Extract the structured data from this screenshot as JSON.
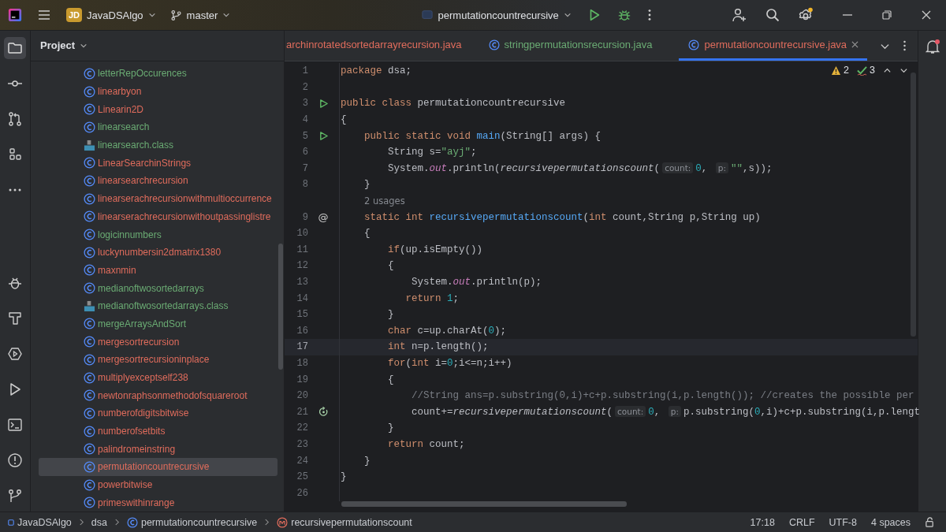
{
  "title_bar": {
    "project_badge": "JD",
    "project": "JavaDSAlgo",
    "branch": "master",
    "run_config": "permutationcountrecursive"
  },
  "project_panel": {
    "title": "Project",
    "items": [
      {
        "name": "letterRepOccurences",
        "kind": "class",
        "color": "#6aab73",
        "selected": false
      },
      {
        "name": "linearbyon",
        "kind": "class",
        "color": "#e06c5c",
        "selected": false
      },
      {
        "name": "Linearin2D",
        "kind": "class",
        "color": "#e06c5c",
        "selected": false
      },
      {
        "name": "linearsearch",
        "kind": "class",
        "color": "#6aab73",
        "selected": false
      },
      {
        "name": "linearsearch.class",
        "kind": "classfile",
        "color": "#6aab73",
        "selected": false
      },
      {
        "name": "LinearSearchinStrings",
        "kind": "class",
        "color": "#e06c5c",
        "selected": false
      },
      {
        "name": "linearsearchrecursion",
        "kind": "class",
        "color": "#e06c5c",
        "selected": false
      },
      {
        "name": "linearserachrecursionwithmultioccurrence",
        "kind": "class",
        "color": "#e06c5c",
        "selected": false
      },
      {
        "name": "linearserachrecursionwithoutpassinglistre",
        "kind": "class",
        "color": "#e06c5c",
        "selected": false
      },
      {
        "name": "logicinnumbers",
        "kind": "class",
        "color": "#6aab73",
        "selected": false
      },
      {
        "name": "luckynumbersin2dmatrix1380",
        "kind": "class",
        "color": "#e06c5c",
        "selected": false
      },
      {
        "name": "maxnmin",
        "kind": "class",
        "color": "#e06c5c",
        "selected": false
      },
      {
        "name": "medianoftwosortedarrays",
        "kind": "class",
        "color": "#6aab73",
        "selected": false
      },
      {
        "name": "medianoftwosortedarrays.class",
        "kind": "classfile",
        "color": "#6aab73",
        "selected": false
      },
      {
        "name": "mergeArraysAndSort",
        "kind": "class",
        "color": "#6aab73",
        "selected": false
      },
      {
        "name": "mergesortrecursion",
        "kind": "class",
        "color": "#e06c5c",
        "selected": false
      },
      {
        "name": "mergesortrecursioninplace",
        "kind": "class",
        "color": "#e06c5c",
        "selected": false
      },
      {
        "name": "multiplyexceptself238",
        "kind": "class",
        "color": "#e06c5c",
        "selected": false
      },
      {
        "name": "newtonraphsonmethodofsquareroot",
        "kind": "class",
        "color": "#e06c5c",
        "selected": false
      },
      {
        "name": "numberofdigitsbitwise",
        "kind": "class",
        "color": "#e06c5c",
        "selected": false
      },
      {
        "name": "numberofsetbits",
        "kind": "class",
        "color": "#e06c5c",
        "selected": false
      },
      {
        "name": "palindromeinstring",
        "kind": "class",
        "color": "#e06c5c",
        "selected": false
      },
      {
        "name": "permutationcountrecursive",
        "kind": "class",
        "color": "#e06c5c",
        "selected": true
      },
      {
        "name": "powerbitwise",
        "kind": "class",
        "color": "#e06c5c",
        "selected": false
      },
      {
        "name": "primeswithinrange",
        "kind": "class",
        "color": "#e06c5c",
        "selected": false
      }
    ]
  },
  "editor_tabs": [
    {
      "label": "archinrotatedsortedarrayrecursion.java",
      "icon": false,
      "color": "#e06c5c",
      "selected": false
    },
    {
      "label": "stringpermutationsrecursion.java",
      "icon": true,
      "color": "#6aab73",
      "selected": false
    },
    {
      "label": "permutationcountrecursive.java",
      "icon": true,
      "color": "#e06c5c",
      "selected": true
    }
  ],
  "inspections": {
    "warnings": "2",
    "weak_warnings": "3"
  },
  "code": [
    {
      "number": "1",
      "tokens": [
        {
          "kind": "kw",
          "text": "package"
        },
        {
          "kind": "plain",
          "text": " dsa;"
        }
      ]
    },
    {
      "number": "2"
    },
    {
      "number": "3",
      "gutter": {
        "kind": "run"
      },
      "tokens": [
        {
          "kind": "kw",
          "text": "public class "
        },
        {
          "kind": "plain",
          "text": "permutationcountrecursive"
        }
      ]
    },
    {
      "number": "4",
      "tokens": [
        {
          "kind": "plain",
          "text": "{"
        }
      ]
    },
    {
      "number": "5",
      "gutter": {
        "kind": "run"
      },
      "tokens": [
        {
          "kind": "kw",
          "text": "    public static void "
        },
        {
          "kind": "decl",
          "text": "main"
        },
        {
          "kind": "plain",
          "text": "(String[] args) {"
        }
      ]
    },
    {
      "number": "6",
      "tokens": [
        {
          "kind": "plain",
          "text": "        String s="
        },
        {
          "kind": "str",
          "text": "\"ayj\""
        },
        {
          "kind": "plain",
          "text": ";"
        }
      ]
    },
    {
      "number": "7",
      "tokens": [
        {
          "kind": "plain",
          "text": "        System."
        },
        {
          "kind": "field",
          "text": "out"
        },
        {
          "kind": "plain",
          "text": ".println("
        },
        {
          "kind": "call",
          "text": "recursivepermutationscount"
        },
        {
          "kind": "plain",
          "text": "("
        },
        {
          "kind": "hint",
          "text": "count:"
        },
        {
          "kind": "num",
          "text": "0"
        },
        {
          "kind": "plain",
          "text": ", "
        },
        {
          "kind": "hint",
          "text": "p:"
        },
        {
          "kind": "str",
          "text": "\"\""
        },
        {
          "kind": "plain",
          "text": ",s));"
        }
      ]
    },
    {
      "number": "8",
      "tokens": [
        {
          "kind": "plain",
          "text": "    }"
        }
      ]
    },
    {
      "usages": "2 usages"
    },
    {
      "number": "9",
      "gutter": {
        "kind": "annotation",
        "text": "@"
      },
      "tokens": [
        {
          "kind": "kw",
          "text": "    static int "
        },
        {
          "kind": "decl",
          "text": "recursivepermutationscount"
        },
        {
          "kind": "plain",
          "text": "("
        },
        {
          "kind": "kw",
          "text": "int "
        },
        {
          "kind": "plain",
          "text": "count,String p,String up)"
        }
      ]
    },
    {
      "number": "10",
      "tokens": [
        {
          "kind": "plain",
          "text": "    {"
        }
      ]
    },
    {
      "number": "11",
      "tokens": [
        {
          "kind": "kw",
          "text": "        if"
        },
        {
          "kind": "plain",
          "text": "(up.isEmpty())"
        }
      ]
    },
    {
      "number": "12",
      "tokens": [
        {
          "kind": "plain",
          "text": "        {"
        }
      ]
    },
    {
      "number": "13",
      "tokens": [
        {
          "kind": "plain",
          "text": "            System."
        },
        {
          "kind": "field",
          "text": "out"
        },
        {
          "kind": "plain",
          "text": ".println(p);"
        }
      ]
    },
    {
      "number": "14",
      "tokens": [
        {
          "kind": "kw",
          "text": "           return "
        },
        {
          "kind": "num",
          "text": "1"
        },
        {
          "kind": "plain",
          "text": ";"
        }
      ]
    },
    {
      "number": "15",
      "tokens": [
        {
          "kind": "plain",
          "text": "        }"
        }
      ]
    },
    {
      "number": "16",
      "tokens": [
        {
          "kind": "kw",
          "text": "        char "
        },
        {
          "kind": "plain",
          "text": "c=up.charAt("
        },
        {
          "kind": "num",
          "text": "0"
        },
        {
          "kind": "plain",
          "text": ");"
        }
      ]
    },
    {
      "number": "17",
      "current": true,
      "tokens": [
        {
          "kind": "kw",
          "text": "        int "
        },
        {
          "kind": "plain",
          "text": "n=p.length();"
        }
      ]
    },
    {
      "number": "18",
      "tokens": [
        {
          "kind": "kw",
          "text": "        for"
        },
        {
          "kind": "plain",
          "text": "("
        },
        {
          "kind": "kw",
          "text": "int "
        },
        {
          "kind": "plain",
          "text": "i="
        },
        {
          "kind": "num",
          "text": "0"
        },
        {
          "kind": "plain",
          "text": ";i<=n;i++)"
        }
      ]
    },
    {
      "number": "19",
      "tokens": [
        {
          "kind": "plain",
          "text": "        {"
        }
      ]
    },
    {
      "number": "20",
      "tokens": [
        {
          "kind": "comment",
          "text": "            //String ans=p.substring(0,i)+c+p.substring(i,p.length()); //creates the possible per"
        }
      ]
    },
    {
      "number": "21",
      "gutter": {
        "kind": "recursion"
      },
      "tokens": [
        {
          "kind": "plain",
          "text": "            count+="
        },
        {
          "kind": "call",
          "text": "recursivepermutationscount"
        },
        {
          "kind": "plain",
          "text": "("
        },
        {
          "kind": "hint",
          "text": "count:"
        },
        {
          "kind": "num",
          "text": "0"
        },
        {
          "kind": "plain",
          "text": ", "
        },
        {
          "kind": "hint",
          "text": "p:"
        },
        {
          "kind": "plain",
          "text": "p.substring("
        },
        {
          "kind": "num",
          "text": "0"
        },
        {
          "kind": "plain",
          "text": ",i)+c+p.substring(i,p.lengt"
        }
      ]
    },
    {
      "number": "22",
      "tokens": [
        {
          "kind": "plain",
          "text": "        }"
        }
      ]
    },
    {
      "number": "23",
      "tokens": [
        {
          "kind": "kw",
          "text": "        return "
        },
        {
          "kind": "plain",
          "text": "count;"
        }
      ]
    },
    {
      "number": "24",
      "tokens": [
        {
          "kind": "plain",
          "text": "    }"
        }
      ]
    },
    {
      "number": "25",
      "tokens": [
        {
          "kind": "plain",
          "text": "}"
        }
      ]
    },
    {
      "number": "26"
    }
  ],
  "status_bar": {
    "breadcrumbs": [
      {
        "kind": "module",
        "text": "JavaDSAlgo"
      },
      {
        "kind": "package",
        "text": "dsa"
      },
      {
        "kind": "class",
        "text": "permutationcountrecursive"
      },
      {
        "kind": "method",
        "text": "recursivepermutationscount"
      }
    ],
    "position": "17:18",
    "line_ending": "CRLF",
    "encoding": "UTF-8",
    "indent": "4 spaces"
  }
}
